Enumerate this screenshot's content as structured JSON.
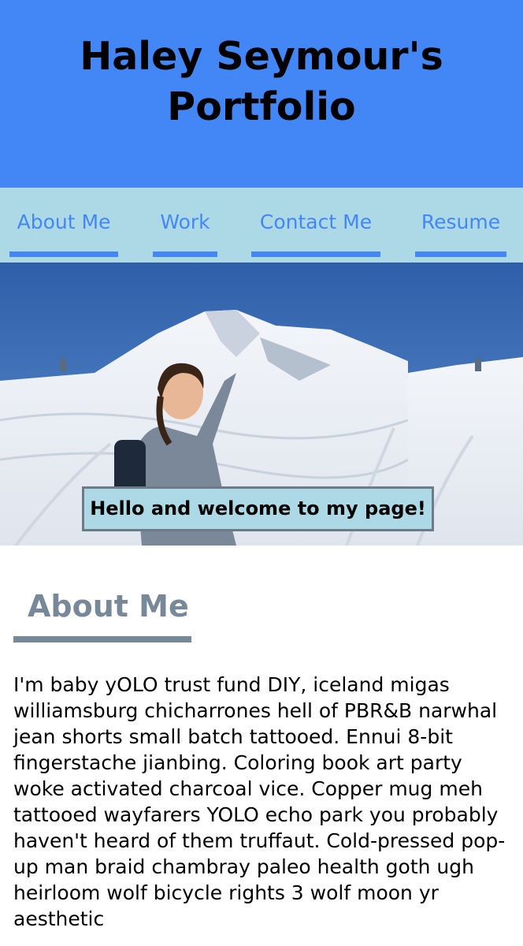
{
  "header": {
    "title": "Haley Seymour's Portfolio"
  },
  "nav": {
    "items": [
      {
        "label": "About Me"
      },
      {
        "label": "Work"
      },
      {
        "label": "Contact Me"
      },
      {
        "label": "Resume"
      }
    ]
  },
  "hero": {
    "image_alt": "Person smiling and pointing at a snowy mountain",
    "banner_text": "Hello and welcome to my page!"
  },
  "about": {
    "heading": "About Me",
    "body": "I'm baby yOLO trust fund DIY, iceland migas williamsburg chicharrones hell of PBR&B narwhal jean shorts small batch tattooed. Ennui 8-bit fingerstache jianbing. Coloring book art party woke activated charcoal vice. Copper mug meh tattooed wayfarers YOLO echo park you probably haven't heard of them truffaut. Cold-pressed pop-up man braid chambray paleo health goth ugh heirloom wolf bicycle rights 3 wolf moon yr aesthetic"
  },
  "colors": {
    "header_bg": "#4287f5",
    "nav_bg": "#add8e6",
    "nav_link": "#4287f5",
    "heading_gray": "#778899"
  }
}
